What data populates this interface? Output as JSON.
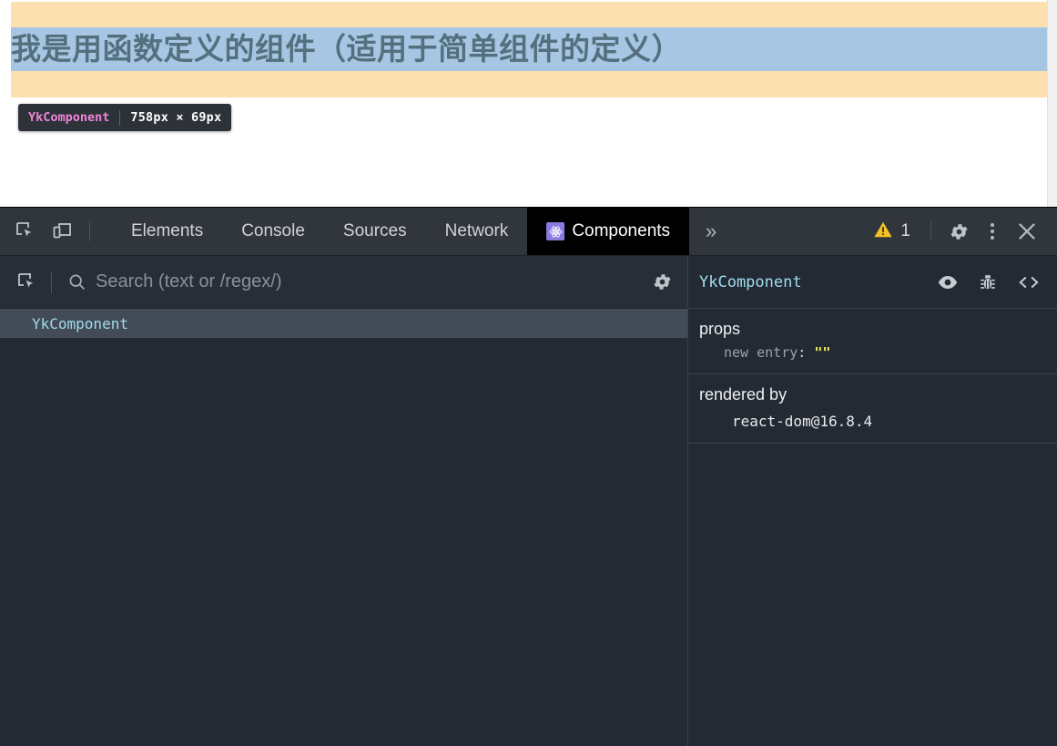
{
  "page": {
    "component_name": "YkComponent",
    "heading": "我是用函数定义的组件（适用于简单组件的定义）",
    "colors": {
      "component_bg": "#fde0b0",
      "heading_bg": "#a6c6e3",
      "heading_text": "#54707e"
    }
  },
  "inspect_tooltip": {
    "name": "YkComponent",
    "size": "758px × 69px"
  },
  "devtools": {
    "toolbar": {
      "inspect_icon": "inspect-element-icon",
      "device_icon": "device-toolbar-icon",
      "tabs": [
        {
          "label": "Elements",
          "active": false
        },
        {
          "label": "Console",
          "active": false
        },
        {
          "label": "Sources",
          "active": false
        },
        {
          "label": "Network",
          "active": false
        },
        {
          "label": "Components",
          "active": true,
          "icon": "react-atom-icon"
        }
      ],
      "more_tabs_label": "»",
      "warning_count": "1",
      "warning_icon": "warning-triangle-icon",
      "settings_icon": "gear-icon",
      "kebab_icon": "more-options-icon",
      "close_icon": "close-icon"
    },
    "tree_panel": {
      "select_element_icon": "select-element-icon",
      "search_icon": "search-icon",
      "search_placeholder": "Search (text or /regex/)",
      "search_value": "",
      "settings_icon": "gear-icon",
      "rows": [
        {
          "label": "YkComponent",
          "selected": true
        }
      ]
    },
    "detail_panel": {
      "title": "YkComponent",
      "actions": [
        {
          "icon": "eye-icon",
          "name": "inspect-dom-icon"
        },
        {
          "icon": "bug-icon",
          "name": "log-to-console-icon"
        },
        {
          "icon": "code-icon",
          "name": "view-source-icon"
        }
      ],
      "props": {
        "title": "props",
        "entries": [
          {
            "key": "new entry",
            "colon": ":",
            "value": "\"\""
          }
        ]
      },
      "rendered_by": {
        "title": "rendered by",
        "entries": [
          "react-dom@16.8.4"
        ]
      }
    }
  }
}
